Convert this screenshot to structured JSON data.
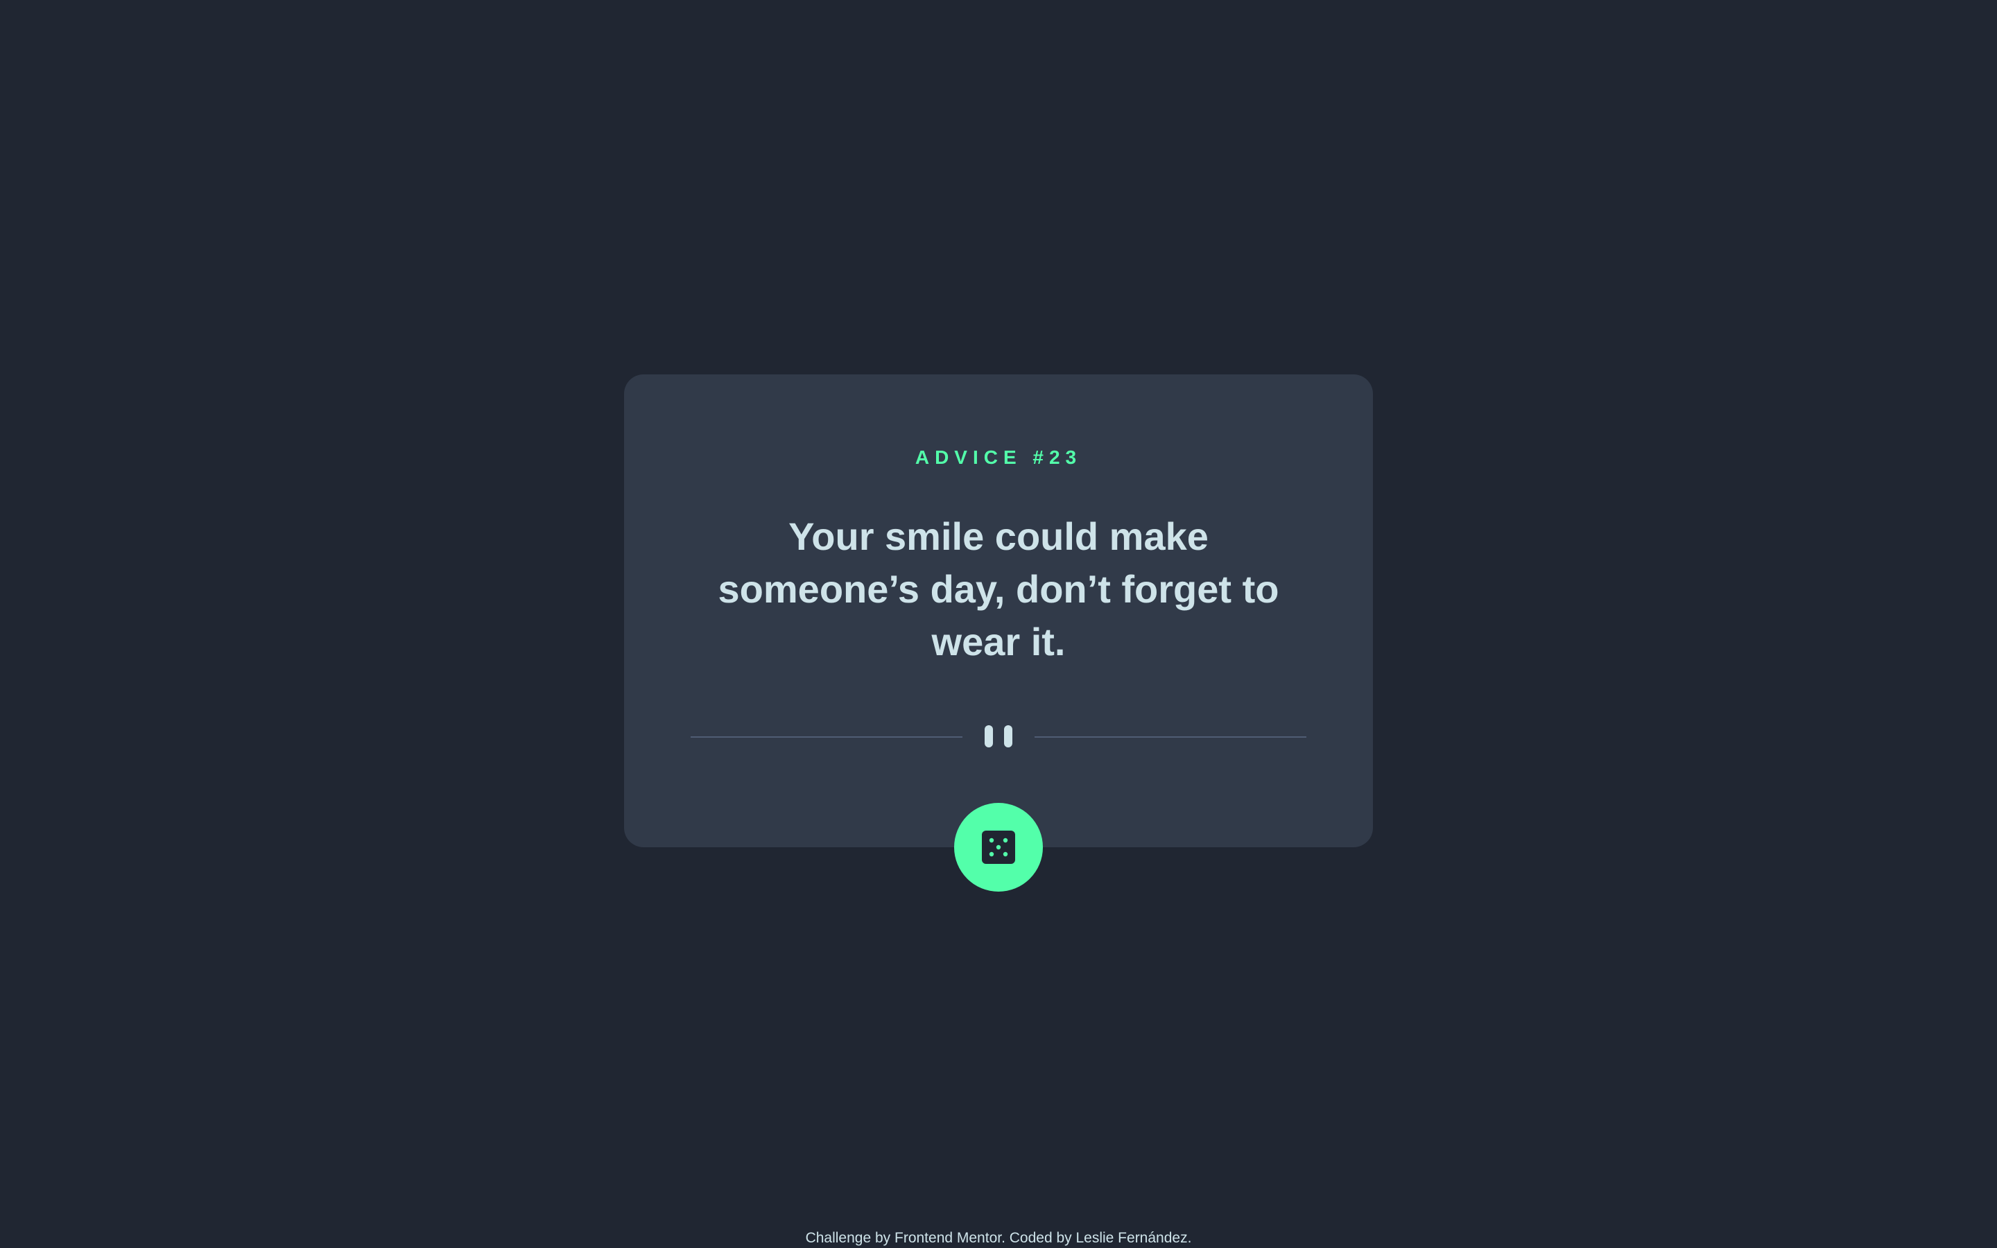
{
  "colors": {
    "background": "#202632",
    "card": "#313a49",
    "accent": "#53ffaa",
    "text": "#cee3e9",
    "divider": "#4f5d74"
  },
  "advice": {
    "id_label": "ADVICE #23",
    "text": "Your smile could make someone’s day, don’t forget to wear it."
  },
  "divider": {
    "icon": "pause-icon"
  },
  "button": {
    "icon": "dice-icon"
  },
  "footer": {
    "text": "Challenge by Frontend Mentor. Coded by Leslie Fernández."
  }
}
